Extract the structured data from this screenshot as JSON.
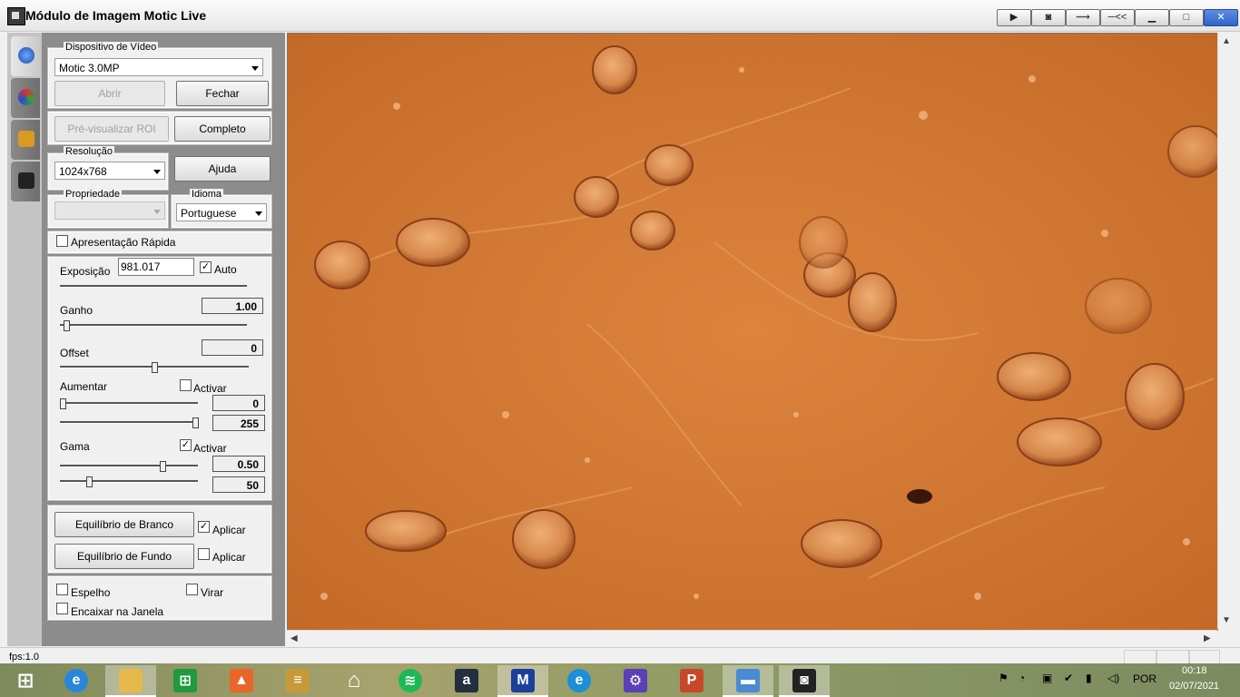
{
  "window": {
    "title": "Módulo de Imagem Motic Live",
    "title_buttons": [
      "▶",
      "📷",
      "—",
      "─<<",
      "—",
      "□",
      "✕"
    ]
  },
  "tabs": [
    "capture-tab",
    "color-tab",
    "tools-tab",
    "camera-tab"
  ],
  "panel": {
    "device_group_label": "Dispositivo de Vídeo",
    "device_selected": "Motic 3.0MP",
    "open_label": "Abrir",
    "close_label": "Fechar",
    "preview_roi_label": "Pré-visualizar ROI",
    "full_label": "Completo",
    "resolution_label": "Resolução",
    "resolution_selected": "1024x768",
    "help_label": "Ajuda",
    "property_label": "Propriedade",
    "property_selected": "",
    "language_label": "Idioma",
    "language_selected": "Portuguese",
    "quick_display_label": "Apresentação Rápida",
    "quick_display_checked": false,
    "exposure_label": "Exposição",
    "exposure_value": "981.017",
    "auto_label": "Auto",
    "auto_checked": true,
    "exposure_slider": 1.0,
    "gain_label": "Ganho",
    "gain_value": "1.00",
    "gain_slider": 0.02,
    "offset_label": "Offset",
    "offset_value": "0",
    "offset_slider": 0.5,
    "boost_label": "Aumentar",
    "boost_activate_label": "Activar",
    "boost_activate_checked": false,
    "boost_low_value": "0",
    "boost_high_value": "255",
    "boost_low_slider": 0.0,
    "boost_high_slider": 1.0,
    "gamma_label": "Gama",
    "gamma_activate_label": "Activar",
    "gamma_activate_checked": true,
    "gamma_value": "0.50",
    "gamma_value2": "50",
    "gamma_slider": 0.75,
    "gamma_slider2": 0.2,
    "white_balance_label": "Equilíbrio de Branco",
    "white_apply_label": "Aplicar",
    "white_apply_checked": true,
    "background_balance_label": "Equilíbrio de Fundo",
    "background_apply_label": "Aplicar",
    "background_apply_checked": false,
    "mirror_label": "Espelho",
    "mirror_checked": false,
    "flip_label": "Virar",
    "flip_checked": false,
    "fit_window_label": "Encaixar na Janela",
    "fit_window_checked": false
  },
  "status": {
    "fps": "fps:1.0"
  },
  "taskbar": {
    "apps": [
      "start",
      "internet-explorer",
      "file-explorer",
      "store",
      "photos",
      "documents",
      "home",
      "spotify",
      "amazon",
      "motic",
      "edge",
      "settings",
      "powerpoint",
      "image-viewer",
      "motic-live"
    ],
    "tray_language": "POR",
    "time": "00:18",
    "date": "02/07/2021"
  },
  "colors": {
    "panel_bg": "#8c8c8c",
    "image_bg": "#d27a36",
    "cell_dark": "#9a4a1e"
  }
}
